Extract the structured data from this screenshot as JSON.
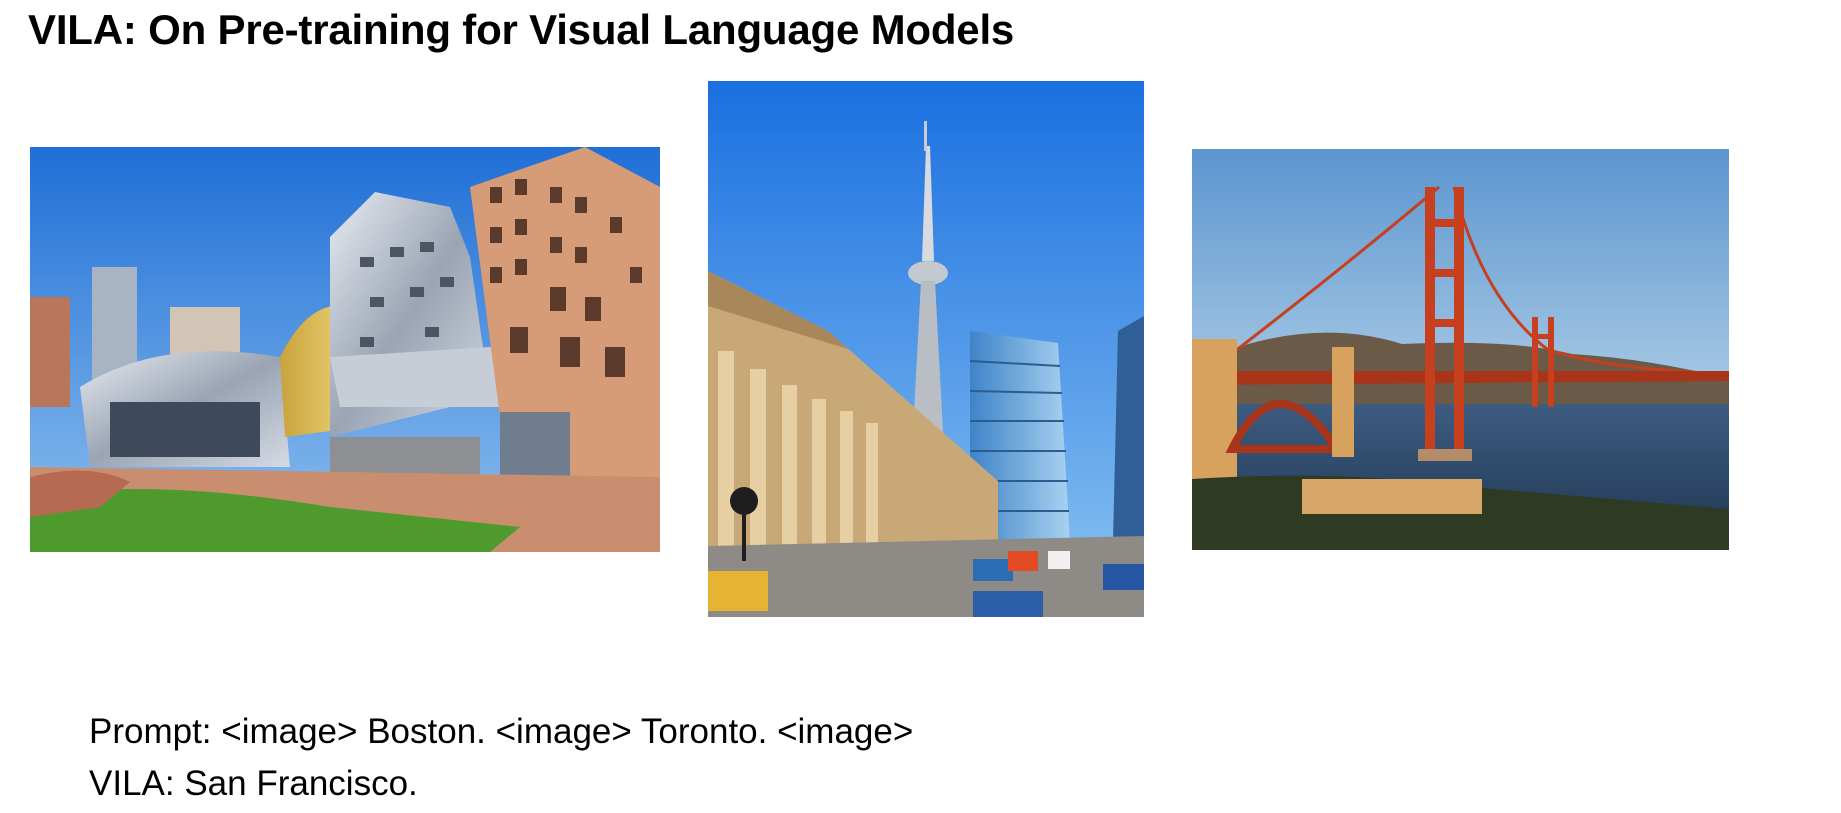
{
  "slide": {
    "title": "VILA: On Pre-training for Visual Language Models"
  },
  "images": [
    {
      "name": "boston-photo",
      "subject": "Stata Center building"
    },
    {
      "name": "toronto-photo",
      "subject": "CN Tower and Union Station street"
    },
    {
      "name": "san-francisco-photo",
      "subject": "Golden Gate Bridge"
    }
  ],
  "caption": {
    "prompt_line": "Prompt: <image> Boston. <image> Toronto. <image>",
    "answer_line": "VILA: San Francisco."
  },
  "colors": {
    "sky_blue": "#2d7fe0",
    "bridge_orange": "#c6401f",
    "grass_green": "#4f9a2c"
  }
}
